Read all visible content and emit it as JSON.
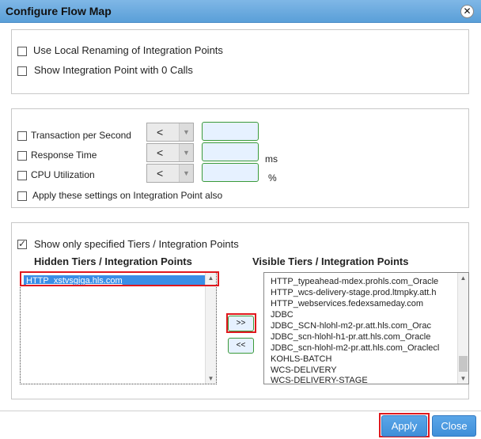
{
  "dialog": {
    "title": "Configure Flow Map",
    "close_glyph": "✕"
  },
  "display_options": {
    "local_renaming": {
      "label": "Use Local Renaming of Integration Points",
      "checked": false
    },
    "zero_calls": {
      "label": "Show Integration Point with 0 Calls",
      "checked": false
    }
  },
  "thresholds": {
    "rows": [
      {
        "label": "Transaction per Second",
        "checked": false,
        "operator": "<",
        "value": "",
        "unit": ""
      },
      {
        "label": "Response Time",
        "checked": false,
        "operator": "<",
        "value": "",
        "unit": "ms"
      },
      {
        "label": "CPU Utilization",
        "checked": false,
        "operator": "<",
        "value": "",
        "unit": "%"
      }
    ],
    "apply_on_ip": {
      "label": "Apply these settings on Integration Point also",
      "checked": false
    }
  },
  "tiers": {
    "show_only": {
      "label": "Show only specified Tiers / Integration Points",
      "checked": true
    },
    "hidden_heading": "Hidden Tiers / Integration Points",
    "visible_heading": "Visible Tiers / Integration Points",
    "hidden_items": [
      "HTTP_xstvsgiga.hls.com"
    ],
    "visible_items": [
      "HTTP_typeahead-mdex.prohls.com_Oracle",
      "HTTP_wcs-delivery-stage.prod.ltmpky.att.h",
      "HTTP_webservices.fedexsameday.com",
      "JDBC",
      "JDBC_SCN-hlohl-m2-pr.att.hls.com_Orac",
      "JDBC_scn-hlohl-h1-pr.att.hls.com_Oracle",
      "JDBC_scn-hlohl-m2-pr.att.hls.com_Oraclecl",
      "KOHLS-BATCH",
      "WCS-DELIVERY",
      "WCS-DELIVERY-STAGE"
    ],
    "move_right_label": ">>",
    "move_left_label": "<<"
  },
  "footer": {
    "apply_label": "Apply",
    "close_label": "Close"
  },
  "colors": {
    "titlebar": "#6aa9df",
    "button": "#4a98e0",
    "highlight": "#e0181e",
    "input_fill": "#e6f1ff",
    "input_border": "#3a9a3a"
  }
}
